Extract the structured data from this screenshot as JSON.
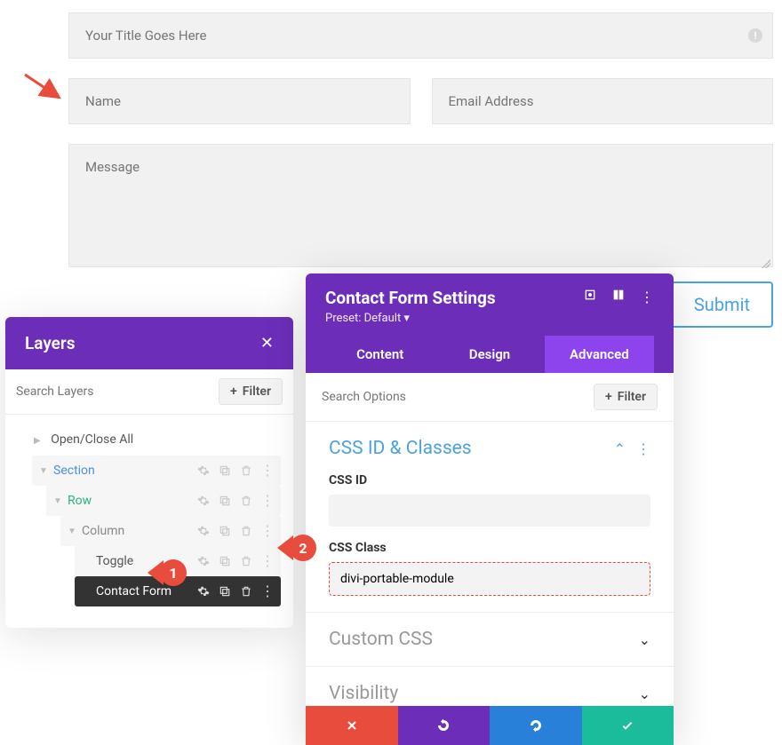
{
  "form": {
    "title_placeholder": "Your Title Goes Here",
    "name_placeholder": "Name",
    "email_placeholder": "Email Address",
    "message_placeholder": "Message",
    "submit_label": "Submit"
  },
  "layers": {
    "title": "Layers",
    "search_placeholder": "Search Layers",
    "filter_label": "Filter",
    "open_close_label": "Open/Close All",
    "items": [
      {
        "label": "Section"
      },
      {
        "label": "Row"
      },
      {
        "label": "Column"
      },
      {
        "label": "Toggle"
      },
      {
        "label": "Contact Form"
      }
    ]
  },
  "settings": {
    "title": "Contact Form Settings",
    "preset": "Preset: Default ▾",
    "tabs": {
      "content": "Content",
      "design": "Design",
      "advanced": "Advanced"
    },
    "search_placeholder": "Search Options",
    "filter_label": "Filter",
    "css_section_title": "CSS ID & Classes",
    "css_id_label": "CSS ID",
    "css_id_value": "",
    "css_class_label": "CSS Class",
    "css_class_value": "divi-portable-module",
    "custom_css_title": "Custom CSS",
    "visibility_title": "Visibility"
  },
  "callouts": {
    "one": "1",
    "two": "2"
  }
}
